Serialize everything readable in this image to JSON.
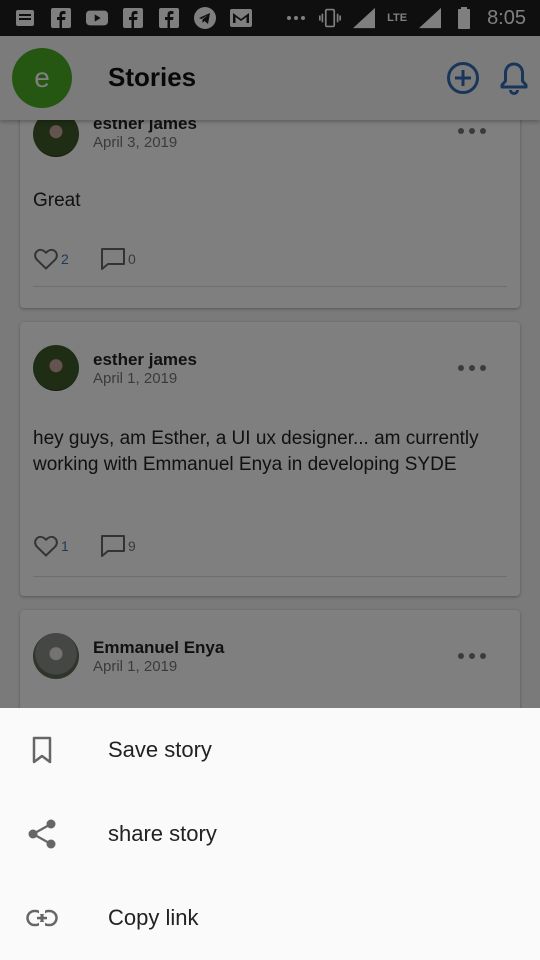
{
  "status_bar": {
    "time": "8:05",
    "network": "LTE",
    "icons": [
      "message-icon",
      "facebook-icon",
      "youtube-icon",
      "facebook-icon",
      "facebook-icon",
      "telegram-icon",
      "gmail-icon",
      "more-dots-icon",
      "vibrate-icon",
      "signal-icon",
      "battery-icon"
    ]
  },
  "appbar": {
    "avatar_letter": "e",
    "title": "Stories",
    "add_icon": "add-circle-icon",
    "notification_icon": "bell-icon",
    "accent": "#2f6db3",
    "avatar_color": "#4caf24"
  },
  "posts": [
    {
      "author": "esther james",
      "date": "April 3, 2019",
      "body": "Great",
      "likes": "2",
      "comments": "0"
    },
    {
      "author": "esther james",
      "date": "April 1, 2019",
      "body": "hey guys,  am Esther,  a UI ux designer...  am currently working with Emmanuel Enya in developing SYDE",
      "likes": "1",
      "comments": "9"
    },
    {
      "author": "Emmanuel Enya",
      "date": "April 1, 2019"
    }
  ],
  "sheet": {
    "items": [
      {
        "label": "Save story",
        "icon": "bookmark-icon"
      },
      {
        "label": "share story",
        "icon": "share-icon"
      },
      {
        "label": "Copy link",
        "icon": "link-icon"
      }
    ]
  }
}
